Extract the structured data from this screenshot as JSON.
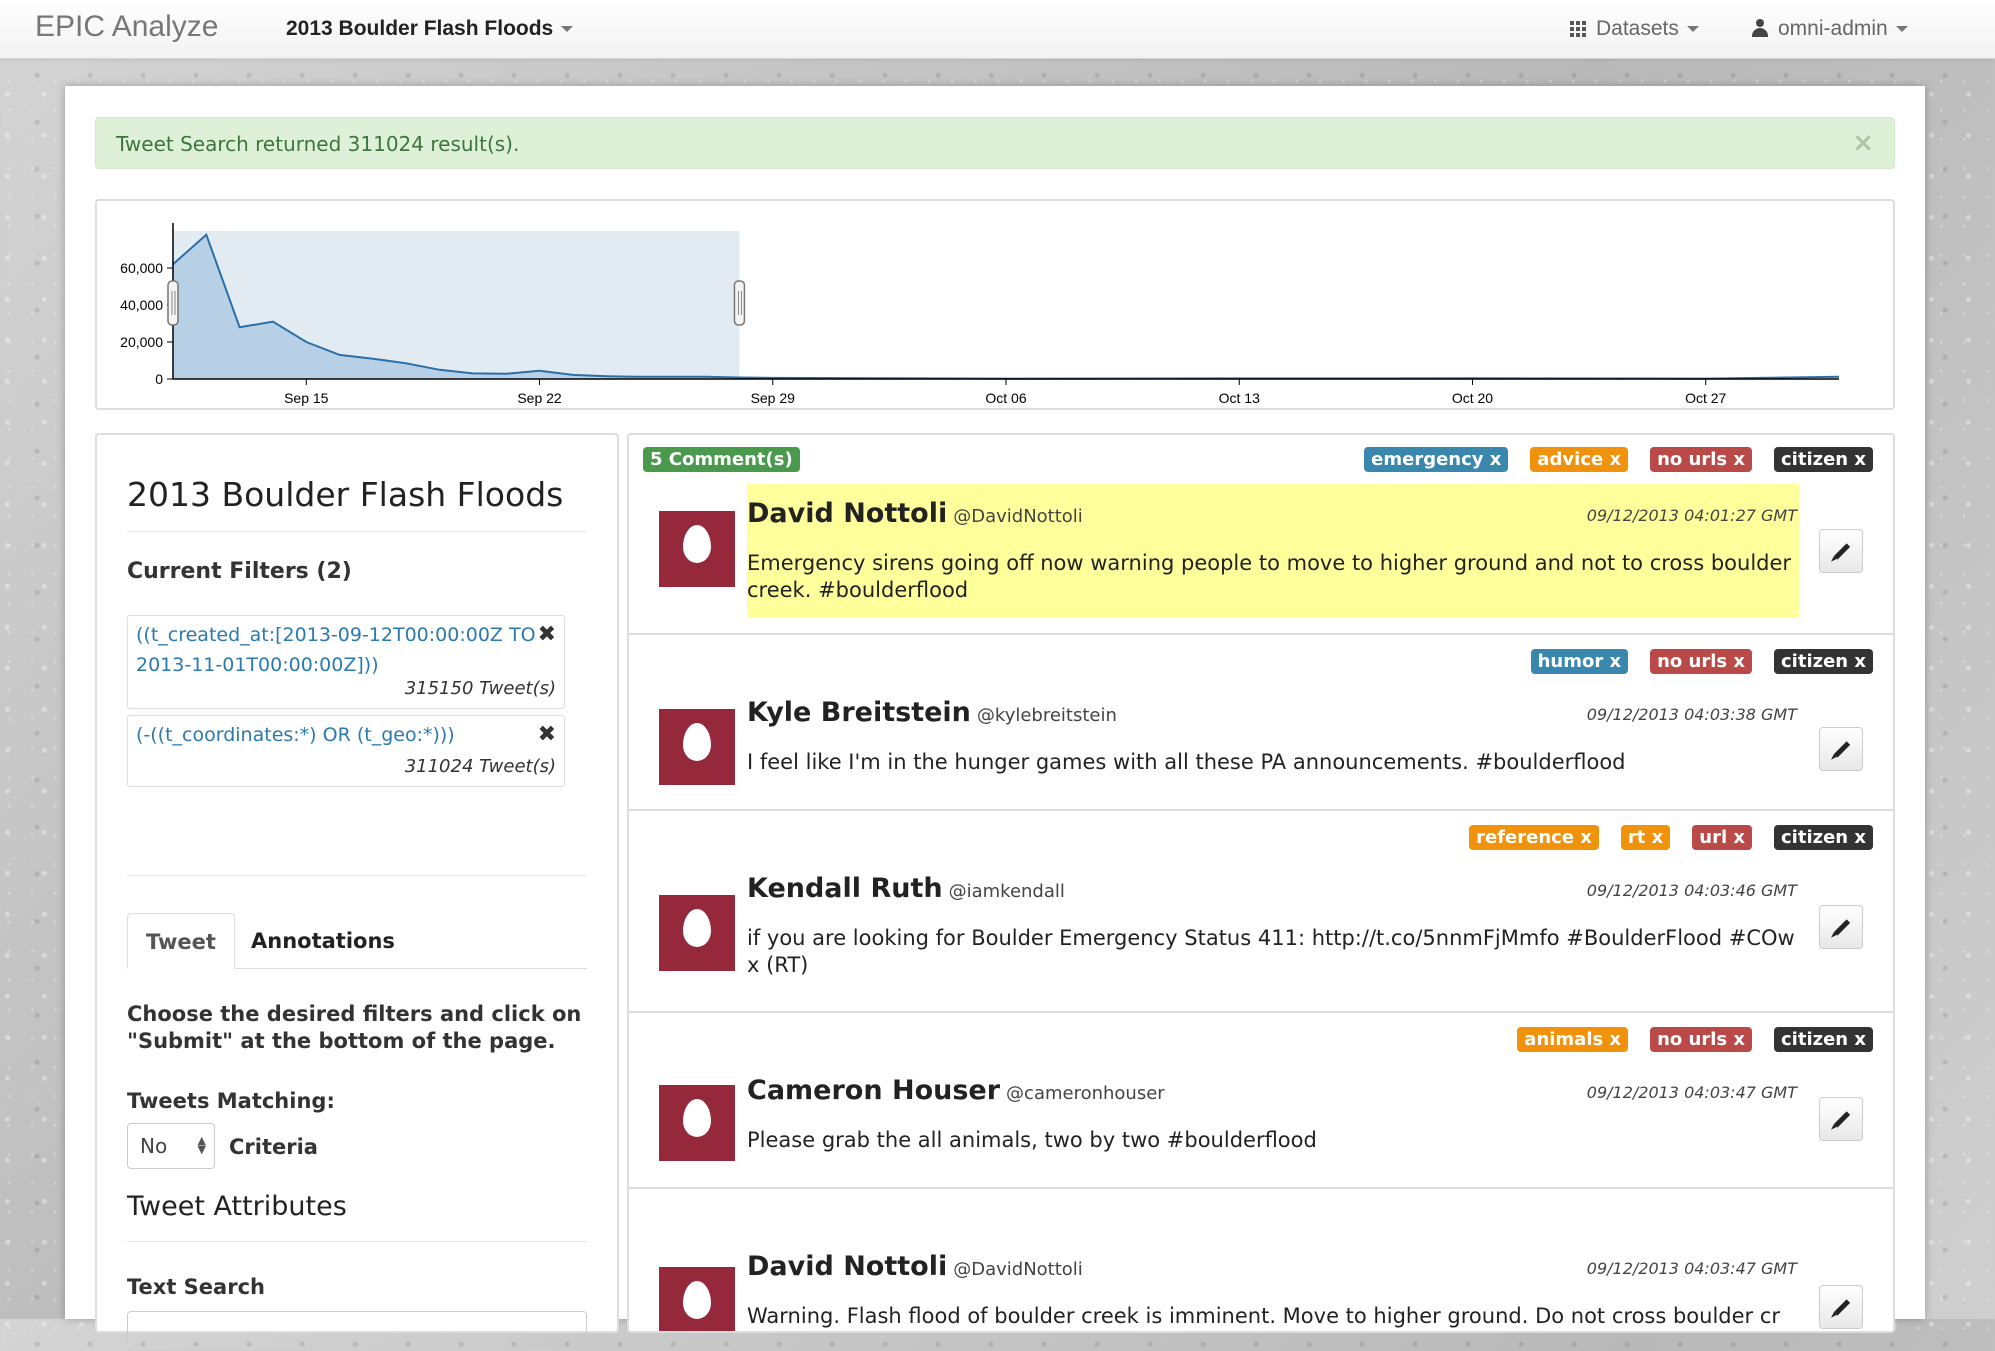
{
  "navbar": {
    "brand": "EPIC Analyze",
    "dataset": "2013 Boulder Flash Floods",
    "datasets_label": "Datasets",
    "user_label": "omni-admin"
  },
  "alert": {
    "message": "Tweet Search returned 311024 result(s).",
    "close": "×"
  },
  "chart_data": {
    "type": "area",
    "x": [
      "2013-09-11",
      "2013-09-12",
      "2013-09-13",
      "2013-09-14",
      "2013-09-15",
      "2013-09-16",
      "2013-09-17",
      "2013-09-18",
      "2013-09-19",
      "2013-09-20",
      "2013-09-21",
      "2013-09-22",
      "2013-09-23",
      "2013-09-24",
      "2013-09-25",
      "2013-09-26",
      "2013-09-27",
      "2013-09-28",
      "2013-09-29",
      "2013-10-06",
      "2013-10-13",
      "2013-10-20",
      "2013-10-27",
      "2013-10-31"
    ],
    "values": [
      62000,
      78000,
      28000,
      31000,
      20000,
      13000,
      11000,
      8500,
      5000,
      3000,
      2800,
      4500,
      2200,
      1500,
      1200,
      1200,
      1200,
      800,
      600,
      200,
      300,
      400,
      200,
      1200
    ],
    "x_ticks": [
      "Sep 15",
      "Sep 22",
      "Sep 29",
      "Oct 06",
      "Oct 13",
      "Oct 20",
      "Oct 27"
    ],
    "y_ticks": [
      "0",
      "20,000",
      "40,000",
      "60,000"
    ],
    "ylim": [
      0,
      80000
    ],
    "selection": {
      "from": "2013-09-11",
      "to": "2013-09-28"
    },
    "colors": {
      "line": "#2b6fa8",
      "fill": "#b7d0e6",
      "brush": "#e3ebf2"
    }
  },
  "left": {
    "title": "2013 Boulder Flash Floods",
    "filters_heading": "Current Filters (2)",
    "filters": [
      {
        "text": "((t_created_at:[2013-09-12T00:00:00Z TO 2013-11-01T00:00:00Z]))",
        "count": "315150 Tweet(s)"
      },
      {
        "text": "(-((t_coordinates:*) OR (t_geo:*)))",
        "count": "311024 Tweet(s)"
      }
    ],
    "tabs": [
      "Tweet",
      "Annotations"
    ],
    "instructions": "Choose the desired filters and click on \"Submit\" at the bottom of the page.",
    "matching_label": "Tweets Matching:",
    "matching_value": "No",
    "criteria_label": "Criteria",
    "attributes_title": "Tweet Attributes",
    "text_search_label": "Text Search"
  },
  "tweets": [
    {
      "comment_badge": "5 Comment(s)",
      "tags": [
        {
          "label": "emergency x",
          "color": "#3a87ad"
        },
        {
          "label": "advice x",
          "color": "#f0920c"
        },
        {
          "label": "no urls x",
          "color": "#b94a48"
        },
        {
          "label": "citizen x",
          "color": "#333333"
        }
      ],
      "name": "David Nottoli",
      "handle": "@DavidNottoli",
      "date": "09/12/2013 04:01:27 GMT",
      "text": "Emergency sirens going off now warning people to move to higher ground and not to cross boulder creek. #boulderflood",
      "highlight": true
    },
    {
      "tags": [
        {
          "label": "humor x",
          "color": "#3a87ad"
        },
        {
          "label": "no urls x",
          "color": "#b94a48"
        },
        {
          "label": "citizen x",
          "color": "#333333"
        }
      ],
      "name": "Kyle Breitstein",
      "handle": "@kylebreitstein",
      "date": "09/12/2013 04:03:38 GMT",
      "text": "I feel like I'm in the hunger games with all these PA announcements. #boulderflood"
    },
    {
      "tags": [
        {
          "label": "reference x",
          "color": "#f0920c"
        },
        {
          "label": "rt x",
          "color": "#f0920c"
        },
        {
          "label": "url x",
          "color": "#b94a48"
        },
        {
          "label": "citizen x",
          "color": "#333333"
        }
      ],
      "name": "Kendall Ruth",
      "handle": "@iamkendall",
      "date": "09/12/2013 04:03:46 GMT",
      "text": "if you are looking for Boulder Emergency Status 411: http://t.co/5nnmFjMmfo #BoulderFlood #COwx (RT)"
    },
    {
      "tags": [
        {
          "label": "animals x",
          "color": "#f0920c"
        },
        {
          "label": "no urls x",
          "color": "#b94a48"
        },
        {
          "label": "citizen x",
          "color": "#333333"
        }
      ],
      "name": "Cameron Houser",
      "handle": "@cameronhouser",
      "date": "09/12/2013 04:03:47 GMT",
      "text": "Please grab the all animals, two by two #boulderflood"
    },
    {
      "tags": [],
      "name": "David Nottoli",
      "handle": "@DavidNottoli",
      "date": "09/12/2013 04:03:47 GMT",
      "text": "Warning. Flash flood of boulder creek is imminent. Move to higher ground. Do not cross boulder cr"
    }
  ]
}
